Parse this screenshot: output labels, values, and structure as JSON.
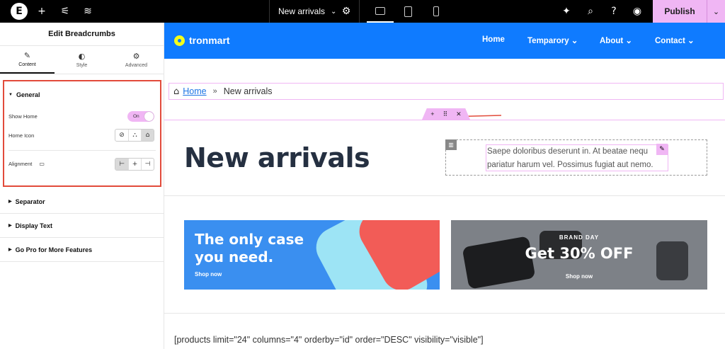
{
  "topbar": {
    "logo_icon": "elementor-logo-icon",
    "page_name": "New arrivals",
    "publish_label": "Publish"
  },
  "panel": {
    "title": "Edit Breadcrumbs",
    "tabs": [
      {
        "label": "Content",
        "icon": "pencil-icon"
      },
      {
        "label": "Style",
        "icon": "half-circle-icon"
      },
      {
        "label": "Advanced",
        "icon": "gear-icon"
      }
    ],
    "general": {
      "heading": "General",
      "show_home_label": "Show Home",
      "show_home_toggle": "On",
      "home_icon_label": "Home Icon",
      "alignment_label": "Alignment"
    },
    "sections": [
      "Separator",
      "Display Text",
      "Go Pro for More Features"
    ]
  },
  "site": {
    "brand": "tronmart",
    "nav": [
      "Home",
      "Temparory",
      "About",
      "Contact"
    ],
    "breadcrumb": {
      "home": "Home",
      "separator": "»",
      "current": "New arrivals"
    },
    "heading": "New arrivals",
    "paragraph_line1": "Saepe doloribus deserunt in. At beatae nequ",
    "paragraph_line2": "pariatur harum vel. Possimus fugiat aut nemo.",
    "banner1": {
      "title_line1": "The only case",
      "title_line2": "you need.",
      "cta": "Shop now"
    },
    "banner2": {
      "kicker": "BRAND DAY",
      "offer": "Get 30% OFF",
      "cta": "Shop now"
    },
    "shortcode": "[products limit=\"24\" columns=\"4\" orderby=\"id\" order=\"DESC\" visibility=\"visible\"]"
  },
  "colors": {
    "accent_pink": "#f0b6f4",
    "nav_blue": "#0f7bff",
    "highlight_red": "#e24b3b"
  }
}
